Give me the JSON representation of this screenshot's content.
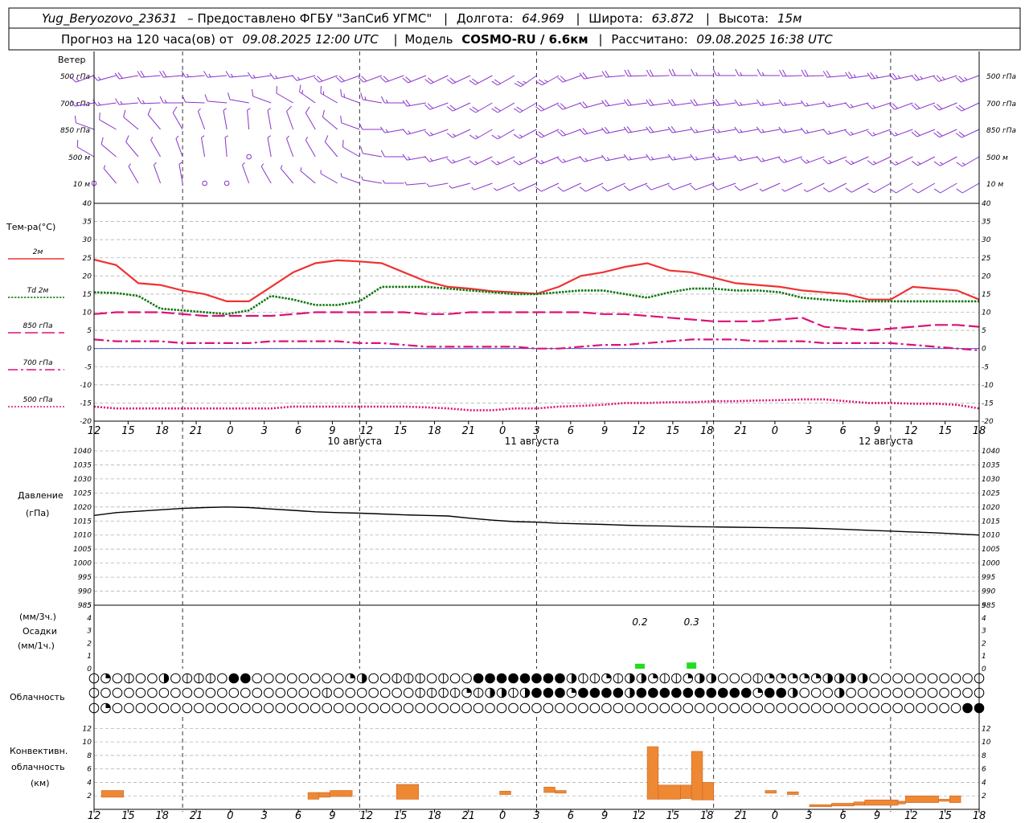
{
  "header": {
    "station": "Yug_Beryozovo_23631",
    "provider": "– Предоставлено ФГБУ \"ЗапСиб УГМС\"",
    "lon_label": "Долгота:",
    "lon": "64.969",
    "lat_label": "Широта:",
    "lat": "63.872",
    "alt_label": "Высота:",
    "alt": "15м",
    "forecast_label": "Прогноз на 120 часа(ов) от",
    "forecast_time": "09.08.2025 12:00 UTC",
    "model_label": "Модель",
    "model": "COSMO-RU / 6.6км",
    "calc_label": "Рассчитано:",
    "calc_time": "09.08.2025 16:38 UTC"
  },
  "wind_panel": {
    "title": "Ветер",
    "levels": [
      "500 гПа",
      "700 гПа",
      "850 гПа",
      "500 м",
      "10 м"
    ]
  },
  "temp_panel": {
    "title": "Тем-ра(°С)",
    "legend": [
      {
        "label": "2м",
        "color": "#ee3333",
        "style": "solid"
      },
      {
        "label": "Td 2м",
        "color": "#117711",
        "style": "dotted"
      },
      {
        "label": "850 гПа",
        "color": "#dd1177",
        "style": "dash"
      },
      {
        "label": "700 гПа",
        "color": "#dd1177",
        "style": "dashdot"
      },
      {
        "label": "500 гПа",
        "color": "#dd1177",
        "style": "fine-dot"
      }
    ]
  },
  "pressure_panel": {
    "title": "Давление",
    "unit": "(гПа)"
  },
  "precip_panel": {
    "unit_top": "(мм/3ч.)",
    "title": "Осадки",
    "unit_bottom": "(мм/1ч.)"
  },
  "cloud_panel": {
    "title": "Облачность"
  },
  "conv_panel": {
    "title_1": "Конвективн.",
    "title_2": "облачность",
    "unit": "(км)"
  },
  "chart_data": {
    "type": "line",
    "x_hours": [
      0,
      3,
      6,
      9,
      12,
      15,
      18,
      21,
      24,
      27,
      30,
      33,
      36,
      39,
      42,
      45,
      48,
      51,
      54,
      57,
      60,
      63,
      66,
      69,
      72,
      75,
      78,
      81,
      84,
      87,
      90,
      93,
      96,
      99,
      102,
      105,
      108,
      111,
      114,
      117,
      120
    ],
    "x_tick_labels": [
      "12",
      "15",
      "18",
      "21",
      "0",
      "3",
      "6",
      "9",
      "12",
      "15",
      "18",
      "21",
      "0",
      "3",
      "6",
      "9",
      "12",
      "15",
      "18",
      "21",
      "0",
      "3",
      "6",
      "9",
      "12",
      "15",
      "18"
    ],
    "day_labels": [
      "10 августа",
      "11 августа",
      "12 августа"
    ],
    "temperature": {
      "ylim": [
        -20,
        40
      ],
      "yticks": [
        -20,
        -15,
        -10,
        -5,
        0,
        5,
        10,
        15,
        20,
        25,
        30,
        35,
        40
      ],
      "series": [
        {
          "name": "2м",
          "values": [
            24.5,
            23,
            18,
            17.5,
            16,
            15,
            13,
            13,
            17,
            21,
            23.5,
            24.3,
            24,
            23.5,
            21,
            18.5,
            17,
            16.5,
            15.8,
            15.5,
            15.1,
            17,
            20,
            21,
            22.5,
            23.5,
            21.5,
            21,
            19.5,
            18,
            17.5,
            17,
            16,
            15.5,
            15,
            13.5,
            13.5,
            17,
            16.5,
            16,
            13.5
          ]
        },
        {
          "name": "Td 2м",
          "values": [
            15.5,
            15.3,
            14.5,
            11,
            10.5,
            10,
            9.5,
            10.5,
            14.5,
            13.5,
            12,
            12,
            13,
            17,
            17,
            17,
            16.5,
            16,
            15.5,
            15,
            15,
            15.5,
            16,
            16,
            15,
            14,
            15.5,
            16.5,
            16.5,
            16,
            16,
            15.5,
            14,
            13.5,
            13,
            13,
            13,
            13,
            13,
            13,
            13
          ]
        },
        {
          "name": "850 гПа",
          "values": [
            9.5,
            10,
            10,
            10,
            9.5,
            9,
            9,
            9,
            9,
            9.5,
            10,
            10,
            10,
            10,
            10,
            9.5,
            9.5,
            10,
            10,
            10,
            10,
            10,
            10,
            9.5,
            9.5,
            9,
            8.5,
            8,
            7.5,
            7.5,
            7.5,
            8,
            8.5,
            6,
            5.5,
            5,
            5.5,
            6,
            6.5,
            6.5,
            6
          ]
        },
        {
          "name": "700 гПа",
          "values": [
            2.5,
            2,
            2,
            2,
            1.5,
            1.5,
            1.5,
            1.5,
            2,
            2,
            2,
            2,
            1.5,
            1.5,
            1,
            0.5,
            0.5,
            0.5,
            0.5,
            0.5,
            0,
            0,
            0.5,
            1,
            1,
            1.5,
            2,
            2.5,
            2.5,
            2.5,
            2,
            2,
            2,
            1.5,
            1.5,
            1.5,
            1.5,
            1,
            0.5,
            0,
            -0.5
          ]
        },
        {
          "name": "500 гПа",
          "values": [
            -16,
            -16.5,
            -16.5,
            -16.5,
            -16.5,
            -16.5,
            -16.5,
            -16.5,
            -16.5,
            -16,
            -16,
            -16,
            -16,
            -16,
            -16,
            -16.2,
            -16.5,
            -17,
            -17,
            -16.5,
            -16.5,
            -16,
            -15.8,
            -15.5,
            -15,
            -15,
            -14.8,
            -14.8,
            -14.5,
            -14.5,
            -14.3,
            -14.2,
            -14,
            -14,
            -14.5,
            -15,
            -15,
            -15.2,
            -15.2,
            -15.5,
            -16.5
          ]
        }
      ]
    },
    "pressure": {
      "ylim": [
        985,
        1040
      ],
      "yticks": [
        985,
        990,
        995,
        1000,
        1005,
        1010,
        1015,
        1020,
        1025,
        1030,
        1035,
        1040
      ],
      "values": [
        1017,
        1018,
        1018.5,
        1019,
        1019.5,
        1019.8,
        1020,
        1019.8,
        1019.3,
        1018.8,
        1018.3,
        1018,
        1017.8,
        1017.5,
        1017.2,
        1017,
        1016.8,
        1016,
        1015.3,
        1014.8,
        1014.6,
        1014.2,
        1014,
        1013.8,
        1013.5,
        1013.3,
        1013.2,
        1013,
        1012.9,
        1012.8,
        1012.7,
        1012.6,
        1012.5,
        1012.3,
        1012,
        1011.7,
        1011.4,
        1011.1,
        1010.8,
        1010.4,
        1010
      ]
    },
    "precipitation": {
      "ylim": [
        0,
        5
      ],
      "yticks": [
        0,
        1,
        2,
        3,
        4,
        5
      ],
      "bars": [
        {
          "hour": 74,
          "value": 0.2,
          "label": "0.2"
        },
        {
          "hour": 81,
          "value": 0.3,
          "label": "0.3"
        }
      ]
    },
    "convective_cloud_km": {
      "ylim": [
        0,
        13
      ],
      "yticks": [
        2,
        4,
        6,
        8,
        10,
        12
      ],
      "bars": [
        {
          "x0": 1,
          "x1": 4,
          "bottom": 1.8,
          "top": 2.8
        },
        {
          "x0": 29,
          "x1": 30.5,
          "bottom": 1.5,
          "top": 2.5
        },
        {
          "x0": 30.5,
          "x1": 32,
          "bottom": 1.8,
          "top": 2.5
        },
        {
          "x0": 32,
          "x1": 35,
          "bottom": 1.9,
          "top": 2.8
        },
        {
          "x0": 41,
          "x1": 44,
          "bottom": 1.5,
          "top": 3.7
        },
        {
          "x0": 55,
          "x1": 56.5,
          "bottom": 2.2,
          "top": 2.7
        },
        {
          "x0": 61,
          "x1": 62.5,
          "bottom": 2.5,
          "top": 3.3
        },
        {
          "x0": 62.5,
          "x1": 64,
          "bottom": 2.4,
          "top": 2.8
        },
        {
          "x0": 75,
          "x1": 76.5,
          "bottom": 1.5,
          "top": 9.3
        },
        {
          "x0": 76.5,
          "x1": 79.5,
          "bottom": 1.5,
          "top": 3.6
        },
        {
          "x0": 79.5,
          "x1": 81,
          "bottom": 1.6,
          "top": 3.6
        },
        {
          "x0": 81,
          "x1": 82.5,
          "bottom": 1.4,
          "top": 8.6
        },
        {
          "x0": 82.5,
          "x1": 84,
          "bottom": 1.4,
          "top": 4
        },
        {
          "x0": 91,
          "x1": 92.5,
          "bottom": 2.4,
          "top": 2.8
        },
        {
          "x0": 94,
          "x1": 95.5,
          "bottom": 2.2,
          "top": 2.6
        },
        {
          "x0": 97,
          "x1": 100,
          "bottom": 0.4,
          "top": 0.7
        },
        {
          "x0": 100,
          "x1": 103,
          "bottom": 0.5,
          "top": 0.9
        },
        {
          "x0": 103,
          "x1": 104.5,
          "bottom": 0.6,
          "top": 1.1
        },
        {
          "x0": 104.5,
          "x1": 109,
          "bottom": 0.6,
          "top": 1.4
        },
        {
          "x0": 109,
          "x1": 110,
          "bottom": 0.8,
          "top": 1.2
        },
        {
          "x0": 110,
          "x1": 114.5,
          "bottom": 1.0,
          "top": 2.0
        },
        {
          "x0": 114.5,
          "x1": 116,
          "bottom": 1.2,
          "top": 1.5
        },
        {
          "x0": 116,
          "x1": 117.5,
          "bottom": 1.0,
          "top": 2.0
        }
      ]
    },
    "cloud_cover_rows": [
      "23121141222100111111113411222121100000000422324432234411123333344441111111111111111111111111111111",
      "11111111111111111111211111112222324424000300004000000000030041114111111111111111111111111111141322",
      "13111111111111111111111111111111111111111111111111111111111111111111111111100011300000000000000000000000000000041"
    ],
    "wind": {
      "levels": [
        "500 гПа",
        "700 гПа",
        "850 гПа",
        "500 м",
        "10 м"
      ],
      "dir": [
        [
          250,
          255,
          260,
          265,
          265,
          265,
          265,
          265,
          262,
          260,
          255,
          250,
          250,
          250,
          250,
          248,
          245,
          245,
          242,
          240,
          235,
          240,
          250,
          260,
          265,
          268,
          268,
          270,
          270,
          270,
          270,
          270,
          268,
          268,
          265,
          262,
          260,
          258,
          255,
          252,
          250
        ],
        [
          260,
          262,
          265,
          268,
          270,
          272,
          275,
          280,
          290,
          300,
          305,
          300,
          290,
          280,
          270,
          260,
          250,
          245,
          240,
          240,
          240,
          245,
          250,
          255,
          260,
          262,
          262,
          262,
          262,
          262,
          262,
          262,
          262,
          260,
          258,
          255,
          252,
          250,
          250,
          248,
          245
        ],
        [
          290,
          300,
          310,
          320,
          330,
          340,
          350,
          355,
          350,
          340,
          330,
          310,
          290,
          270,
          260,
          255,
          250,
          245,
          240,
          240,
          242,
          245,
          250,
          255,
          258,
          260,
          260,
          260,
          260,
          260,
          260,
          260,
          260,
          258,
          255,
          252,
          250,
          250,
          248,
          246,
          245
        ],
        [
          300,
          310,
          320,
          330,
          340,
          350,
          355,
          0,
          350,
          340,
          330,
          320,
          300,
          280,
          270,
          260,
          255,
          250,
          245,
          245,
          245,
          248,
          252,
          255,
          258,
          260,
          260,
          260,
          260,
          260,
          258,
          255,
          252,
          250,
          248,
          246,
          245,
          244,
          243,
          242,
          240
        ],
        [
          0,
          320,
          330,
          340,
          350,
          0,
          350,
          340,
          330,
          320,
          310,
          300,
          290,
          280,
          270,
          265,
          260,
          255,
          250,
          248,
          246,
          245,
          245,
          245,
          246,
          248,
          250,
          250,
          250,
          250,
          248,
          246,
          245,
          244,
          243,
          242,
          241,
          240,
          240,
          240,
          240
        ]
      ],
      "speed": [
        [
          15,
          15,
          20,
          20,
          20,
          15,
          15,
          15,
          15,
          15,
          15,
          20,
          20,
          20,
          20,
          20,
          20,
          20,
          20,
          20,
          25,
          25,
          20,
          20,
          20,
          20,
          20,
          20,
          15,
          15,
          15,
          15,
          20,
          20,
          20,
          25,
          25,
          25,
          25,
          25,
          25
        ],
        [
          15,
          15,
          15,
          15,
          15,
          10,
          10,
          10,
          10,
          10,
          15,
          15,
          15,
          15,
          15,
          20,
          20,
          20,
          20,
          20,
          20,
          20,
          20,
          20,
          20,
          20,
          20,
          20,
          20,
          20,
          15,
          15,
          15,
          15,
          15,
          15,
          15,
          20,
          20,
          20,
          20
        ],
        [
          10,
          10,
          10,
          10,
          10,
          5,
          5,
          5,
          5,
          10,
          10,
          10,
          10,
          10,
          15,
          15,
          15,
          15,
          15,
          15,
          15,
          20,
          20,
          20,
          20,
          20,
          20,
          20,
          15,
          15,
          15,
          15,
          15,
          15,
          15,
          15,
          15,
          15,
          20,
          20,
          20
        ],
        [
          10,
          10,
          10,
          5,
          5,
          5,
          5,
          0,
          5,
          5,
          5,
          10,
          10,
          10,
          10,
          15,
          15,
          15,
          15,
          15,
          15,
          15,
          15,
          15,
          15,
          15,
          15,
          15,
          15,
          15,
          15,
          15,
          15,
          15,
          15,
          15,
          15,
          15,
          15,
          15,
          15
        ],
        [
          0,
          5,
          5,
          5,
          5,
          0,
          0,
          5,
          5,
          5,
          5,
          5,
          5,
          5,
          5,
          5,
          5,
          5,
          5,
          5,
          10,
          10,
          10,
          10,
          10,
          10,
          10,
          10,
          10,
          10,
          10,
          5,
          5,
          5,
          10,
          10,
          10,
          10,
          10,
          10,
          10
        ]
      ]
    }
  }
}
